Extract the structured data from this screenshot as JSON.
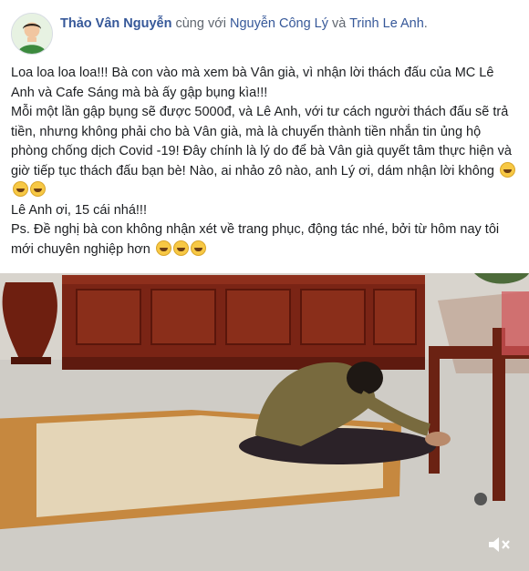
{
  "post": {
    "author": "Thảo Vân Nguyễn",
    "with_text": " cùng với ",
    "tagged_1": "Nguyễn Công Lý",
    "and_text": " và ",
    "tagged_2": "Trinh Le Anh",
    "period": ".",
    "paragraphs": [
      "Loa loa loa loa!!! Bà con vào mà xem bà Vân già, vì nhận lời thách đấu của MC Lê Anh và Cafe Sáng mà bà ấy gập bụng kìa!!!",
      "Mỗi một lần gập bụng sẽ được 5000đ, và Lê Anh, với tư cách người thách đấu sẽ trả tiền, nhưng không phải cho bà Vân già, mà là chuyển thành tiền nhắn tin ủng hộ phòng chống dịch Covid -19! Đây chính là lý do để bà Vân già quyết tâm thực hiện và giờ tiếp tục thách đấu bạn bè! Nào, ai nhảo zô nào, anh Lý ơi, dám nhận lời không",
      "Lê Anh ơi, 15 cái nhá!!!",
      "Ps. Đề nghị bà con không nhận xét về trang phục, động tác nhé, bởi từ hôm nay tôi mới chuyên nghiệp hơn"
    ]
  },
  "icons": {
    "emoji": "grinning-face-icon",
    "mute": "speaker-muted-icon"
  },
  "colors": {
    "link": "#365899",
    "text": "#1c1e21",
    "meta": "#606770",
    "emoji": "#f7c844"
  }
}
